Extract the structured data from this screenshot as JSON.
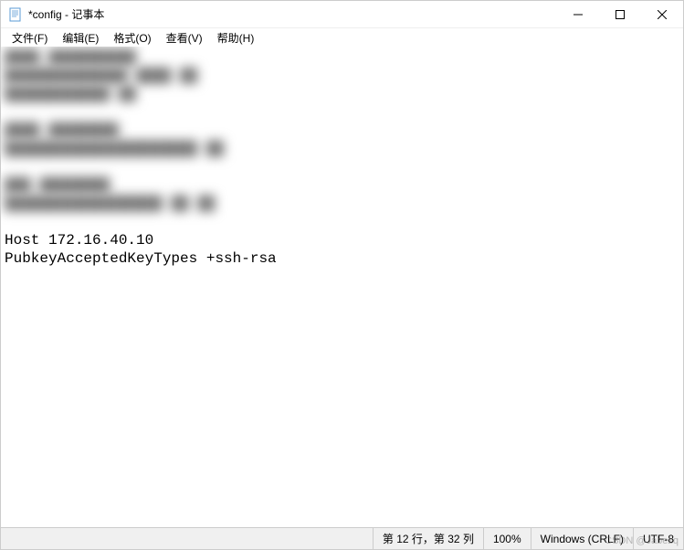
{
  "window": {
    "title": "*config - 记事本"
  },
  "menu": {
    "file": "文件(F)",
    "edit": "编辑(E)",
    "format": "格式(O)",
    "view": "查看(V)",
    "help": "帮助(H)"
  },
  "content": {
    "blur1_line1": "████  ██████████",
    "blur1_line2": "  ██████████████  ████ ██",
    "blur1_line3": "  ████████████  ██",
    "blur2_line1": "████  ████████",
    "blur2_line2": "  ██████████████████████  ██",
    "blur3_line1": "███  ████████",
    "blur3_line2": "  ██████████████████   ██ ██",
    "line1": "Host 172.16.40.10",
    "line2": "PubkeyAcceptedKeyTypes +ssh-rsa"
  },
  "status": {
    "position": "第 12 行，第 32 列",
    "zoom": "100%",
    "lineending": "Windows (CRLF)",
    "encoding": "UTF-8"
  },
  "watermark": "CSDN @Jabezq"
}
